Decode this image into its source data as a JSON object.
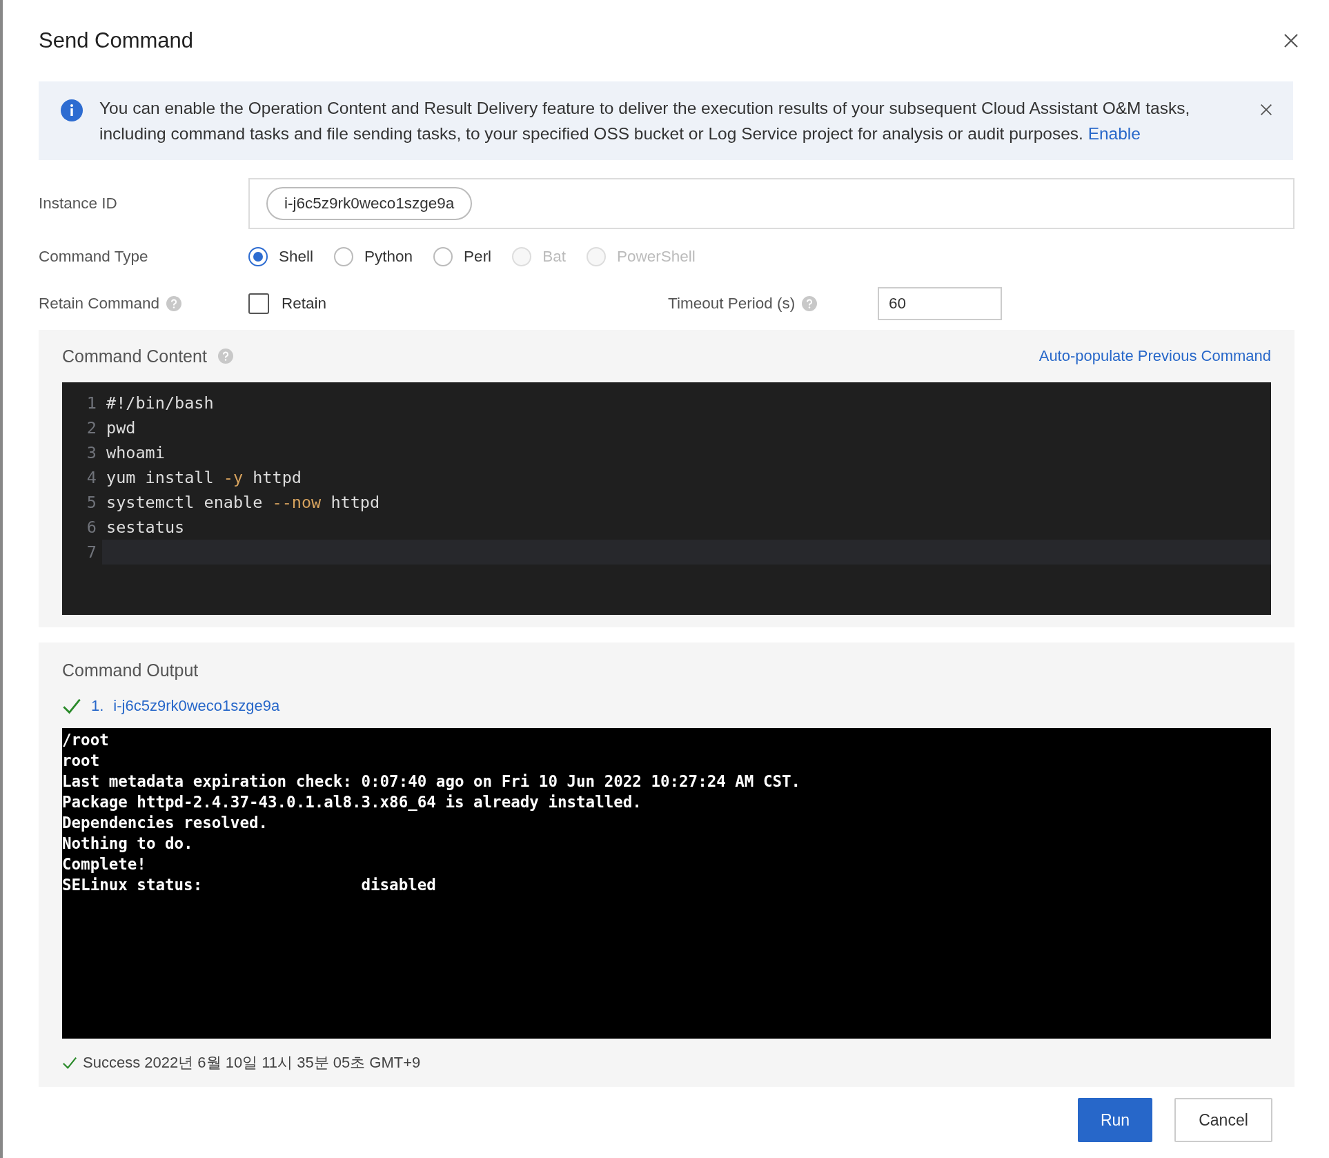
{
  "dialog": {
    "title": "Send Command"
  },
  "banner": {
    "message": "You can enable the Operation Content and Result Delivery feature to deliver the execution results of your subsequent Cloud Assistant O&M tasks, including command tasks and file sending tasks, to your specified OSS bucket or Log Service project for analysis or audit purposes.",
    "link": "Enable"
  },
  "instance_id": {
    "label": "Instance ID",
    "tags": [
      "i-j6c5z9rk0weco1szge9a"
    ]
  },
  "command_type": {
    "label": "Command Type",
    "options": [
      {
        "label": "Shell",
        "selected": true,
        "disabled": false
      },
      {
        "label": "Python",
        "selected": false,
        "disabled": false
      },
      {
        "label": "Perl",
        "selected": false,
        "disabled": false
      },
      {
        "label": "Bat",
        "selected": false,
        "disabled": true
      },
      {
        "label": "PowerShell",
        "selected": false,
        "disabled": true
      }
    ]
  },
  "retain_command": {
    "label": "Retain Command",
    "checkbox_label": "Retain",
    "checked": false
  },
  "timeout": {
    "label": "Timeout Period (s)",
    "value": "60"
  },
  "command_content": {
    "title": "Command Content",
    "link": "Auto-populate Previous Command",
    "lines": [
      {
        "number": "1",
        "current": false,
        "tokens": [
          {
            "text": "#!/bin/bash",
            "kind": "plain"
          }
        ]
      },
      {
        "number": "2",
        "current": false,
        "tokens": [
          {
            "text": "pwd",
            "kind": "plain"
          }
        ]
      },
      {
        "number": "3",
        "current": false,
        "tokens": [
          {
            "text": "whoami",
            "kind": "plain"
          }
        ]
      },
      {
        "number": "4",
        "current": false,
        "tokens": [
          {
            "text": "yum install ",
            "kind": "plain"
          },
          {
            "text": "-y",
            "kind": "flag"
          },
          {
            "text": " httpd",
            "kind": "plain"
          }
        ]
      },
      {
        "number": "5",
        "current": false,
        "tokens": [
          {
            "text": "systemctl enable ",
            "kind": "plain"
          },
          {
            "text": "--now",
            "kind": "flag"
          },
          {
            "text": " httpd",
            "kind": "plain"
          }
        ]
      },
      {
        "number": "6",
        "current": false,
        "tokens": [
          {
            "text": "sestatus",
            "kind": "plain"
          }
        ]
      },
      {
        "number": "7",
        "current": true
      }
    ]
  },
  "command_output": {
    "title": "Command Output",
    "instances": [
      {
        "index": "1.",
        "id": "i-j6c5z9rk0weco1szge9a",
        "succeeded": true
      }
    ],
    "output_lines": [
      "/root",
      "root",
      "Last metadata expiration check: 0:07:40 ago on Fri 10 Jun 2022 10:27:24 AM CST.",
      "Package httpd-2.4.37-43.0.1.al8.3.x86_64 is already installed.",
      "Dependencies resolved.",
      "Nothing to do.",
      "Complete!",
      "SELinux status:                 disabled"
    ],
    "result": {
      "succeeded": true,
      "label": "Success",
      "time": "2022년 6월 10일 11시 35분 05초 GMT+9"
    }
  },
  "buttons": [
    {
      "label": "Run",
      "kind": "primary"
    },
    {
      "label": "Cancel",
      "kind": "secondary"
    }
  ]
}
